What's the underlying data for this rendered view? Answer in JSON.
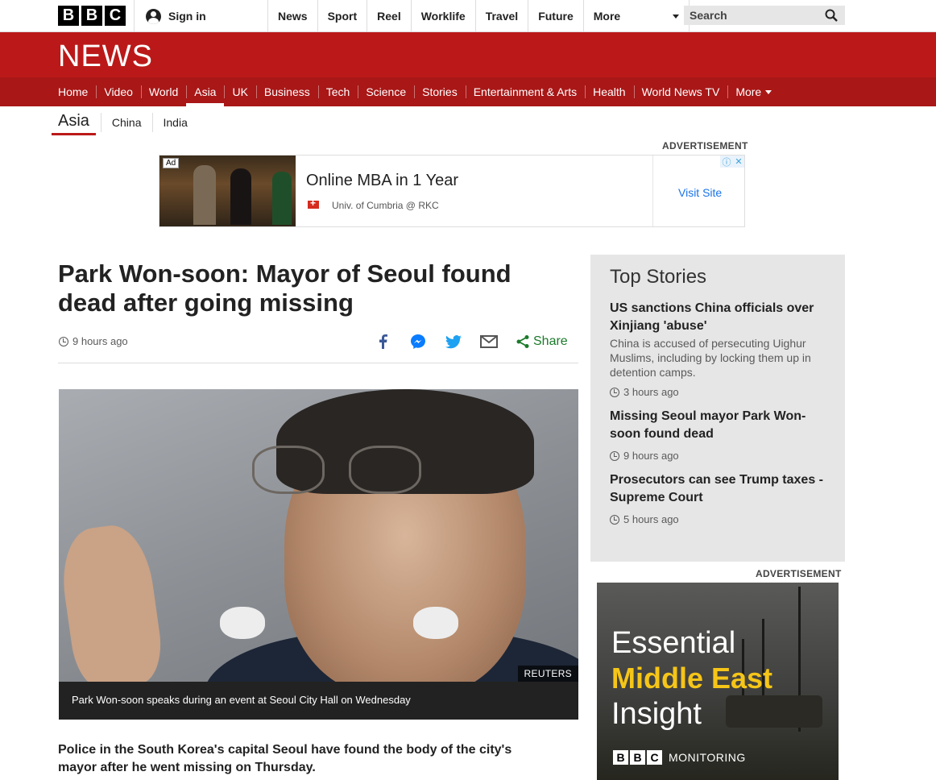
{
  "masthead": {
    "logo": [
      "B",
      "B",
      "C"
    ],
    "signin_label": "Sign in",
    "nav": [
      "News",
      "Sport",
      "Reel",
      "Worklife",
      "Travel",
      "Future"
    ],
    "more_label": "More",
    "search_label": "Search"
  },
  "news_banner": {
    "title": "NEWS",
    "brand_color": "#bb1919"
  },
  "section_nav": {
    "items": [
      "Home",
      "Video",
      "World",
      "Asia",
      "UK",
      "Business",
      "Tech",
      "Science",
      "Stories",
      "Entertainment & Arts",
      "Health",
      "World News TV"
    ],
    "active": "Asia",
    "more_label": "More"
  },
  "sub_nav": {
    "active": "Asia",
    "items": [
      "China",
      "India"
    ]
  },
  "ad_top": {
    "label": "ADVERTISEMENT",
    "tag": "Ad",
    "title": "Online MBA in 1 Year",
    "sub": "Univ. of Cumbria @ RKC",
    "cta": "Visit Site"
  },
  "article": {
    "headline": "Park Won-soon: Mayor of Seoul found dead after going missing",
    "time": "9 hours ago",
    "share_label": "Share",
    "image_credit": "REUTERS",
    "caption": "Park Won-soon speaks during an event at Seoul City Hall on Wednesday",
    "intro": "Police in the South Korea's capital Seoul have found the body of the city's mayor after he went missing on Thursday."
  },
  "top_stories": {
    "title": "Top Stories",
    "items": [
      {
        "headline": "US sanctions China officials over Xinjiang 'abuse'",
        "summary": "China is accused of persecuting Uighur Muslims, including by locking them up in detention camps.",
        "time": "3 hours ago"
      },
      {
        "headline": "Missing Seoul mayor Park Won-soon found dead",
        "summary": "",
        "time": "9 hours ago"
      },
      {
        "headline": "Prosecutors can see Trump taxes - Supreme Court",
        "summary": "",
        "time": "5 hours ago"
      }
    ]
  },
  "side_ad": {
    "label": "ADVERTISEMENT",
    "line1": "Essential",
    "line2": "Middle East",
    "line3": "Insight",
    "brand": [
      "B",
      "B",
      "C"
    ],
    "brand_suffix": "MONITORING",
    "accent": "#f5c518"
  }
}
